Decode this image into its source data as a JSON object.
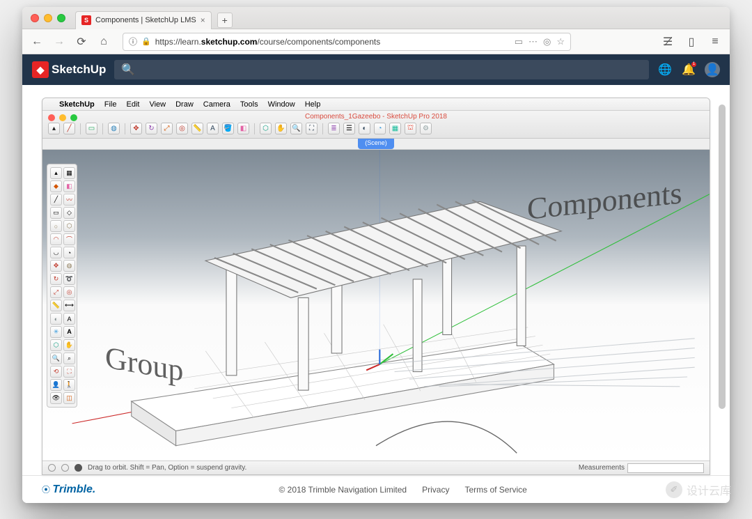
{
  "browser": {
    "tab_title": "Components | SketchUp LMS",
    "url_prefix": "https://learn.",
    "url_host": "sketchup.com",
    "url_path": "/course/components/components",
    "add_tab": "+"
  },
  "topbar": {
    "brand": "SketchUp",
    "notification_count": "1"
  },
  "sketchup": {
    "app_name": "SketchUp",
    "menus": [
      "File",
      "Edit",
      "View",
      "Draw",
      "Camera",
      "Tools",
      "Window",
      "Help"
    ],
    "doc_title": "Components_1Gazeebo - SketchUp Pro 2018",
    "scene_label": "(Scene)",
    "status_hint": "Drag to orbit. Shift = Pan, Option = suspend gravity.",
    "measurements_label": "Measurements",
    "viewport_labels": {
      "components": "Components",
      "group": "Group"
    }
  },
  "footer": {
    "company": "Trimble.",
    "copyright": "© 2018 Trimble Navigation Limited",
    "privacy": "Privacy",
    "tos": "Terms of Service"
  },
  "watermark": {
    "text": "设计云库"
  },
  "colors": {
    "brand_red": "#e62525",
    "topbar_bg": "#21344a",
    "accent_blue": "#4f8ef0",
    "trimble_blue": "#0063a3"
  }
}
